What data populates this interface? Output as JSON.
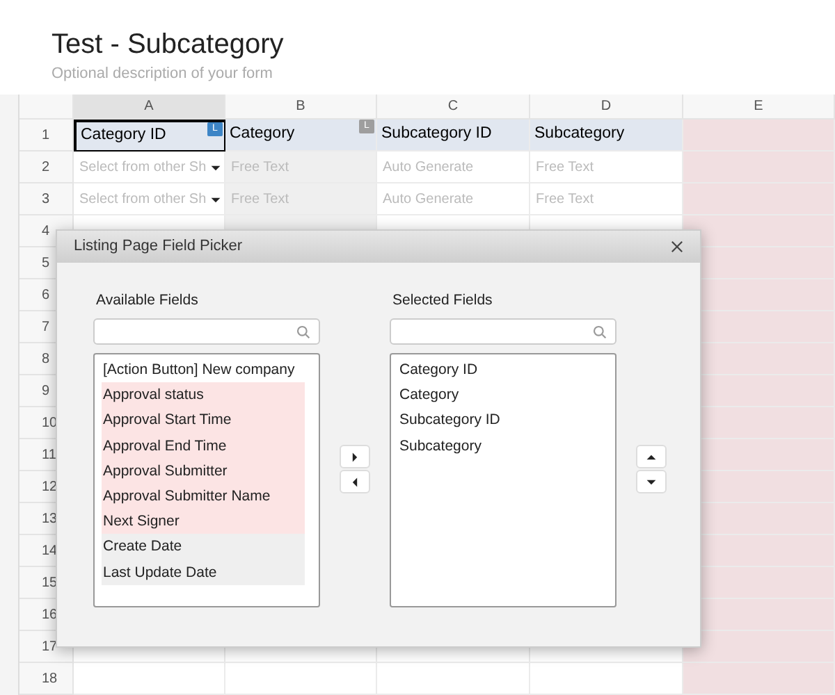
{
  "form": {
    "title": "Test - Subcategory",
    "description": "Optional description of your form"
  },
  "columns": [
    {
      "label": "A",
      "selected": true,
      "kind": "normal"
    },
    {
      "label": "B",
      "selected": false,
      "kind": "readonly"
    },
    {
      "label": "C",
      "selected": false,
      "kind": "normal"
    },
    {
      "label": "D",
      "selected": false,
      "kind": "normal"
    },
    {
      "label": "E",
      "selected": false,
      "kind": "unused"
    }
  ],
  "rows": [
    {
      "number": "1",
      "kind": "header",
      "cells": [
        {
          "text": "Category ID",
          "selected": true,
          "badge": {
            "text": "L",
            "color": "#3d85c6"
          }
        },
        {
          "text": "Category",
          "selected": false,
          "badge": {
            "text": "L",
            "color": "#9e9e9e"
          }
        },
        {
          "text": "Subcategory ID",
          "selected": false
        },
        {
          "text": "Subcategory",
          "selected": false
        }
      ]
    },
    {
      "number": "2",
      "kind": "hint",
      "cells": [
        {
          "text": "Select from other Sh",
          "dropdown": true
        },
        {
          "text": "Free Text"
        },
        {
          "text": "Auto Generate"
        },
        {
          "text": "Free Text"
        }
      ]
    },
    {
      "number": "3",
      "kind": "hint",
      "cells": [
        {
          "text": "Select from other Sh",
          "dropdown": true
        },
        {
          "text": "Free Text"
        },
        {
          "text": "Auto Generate"
        },
        {
          "text": "Free Text"
        }
      ]
    },
    {
      "number": "4",
      "kind": "hint",
      "cells": []
    },
    {
      "number": "5",
      "kind": "empty",
      "cells": []
    },
    {
      "number": "6",
      "kind": "empty",
      "cells": []
    },
    {
      "number": "7",
      "kind": "empty",
      "cells": []
    },
    {
      "number": "8",
      "kind": "empty",
      "cells": []
    },
    {
      "number": "9",
      "kind": "empty",
      "cells": []
    },
    {
      "number": "10",
      "kind": "empty",
      "cells": []
    },
    {
      "number": "11",
      "kind": "empty",
      "cells": []
    },
    {
      "number": "12",
      "kind": "empty",
      "cells": []
    },
    {
      "number": "13",
      "kind": "empty",
      "cells": []
    },
    {
      "number": "14",
      "kind": "empty",
      "cells": []
    },
    {
      "number": "15",
      "kind": "empty",
      "cells": []
    },
    {
      "number": "16",
      "kind": "empty",
      "cells": []
    },
    {
      "number": "17",
      "kind": "empty",
      "cells": []
    },
    {
      "number": "18",
      "kind": "empty",
      "cells": []
    }
  ],
  "dialog": {
    "title": "Listing Page Field Picker",
    "available": {
      "label": "Available Fields",
      "items": [
        {
          "text": "[Action Button] New company",
          "color": "#ffffff"
        },
        {
          "text": "Approval status",
          "color": "#fce4e4"
        },
        {
          "text": "Approval Start Time",
          "color": "#fce4e4"
        },
        {
          "text": "Approval End Time",
          "color": "#fce4e4"
        },
        {
          "text": "Approval Submitter",
          "color": "#fce4e4"
        },
        {
          "text": "Approval Submitter Name",
          "color": "#fce4e4"
        },
        {
          "text": "Next Signer",
          "color": "#fce4e4"
        },
        {
          "text": "Create Date",
          "color": "#efefef"
        },
        {
          "text": "Last Update Date",
          "color": "#efefef"
        }
      ]
    },
    "selected": {
      "label": "Selected Fields",
      "items": [
        {
          "text": "Category ID"
        },
        {
          "text": "Category"
        },
        {
          "text": "Subcategory ID"
        },
        {
          "text": "Subcategory"
        }
      ]
    }
  }
}
